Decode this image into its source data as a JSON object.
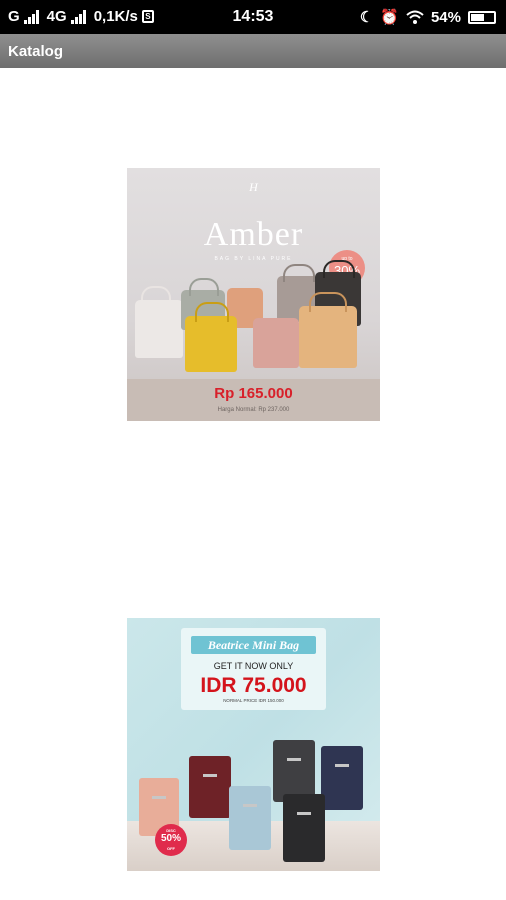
{
  "status_bar": {
    "carrier": "G",
    "network": "4G",
    "speed": "0,1K/s",
    "time": "14:53",
    "battery": "54%"
  },
  "app_bar": {
    "title": "Katalog"
  },
  "catalog": {
    "items": [
      {
        "brand_mark": "H",
        "title": "Amber",
        "subtitle": "BAG BY LINA PURE",
        "discount_small": "up to",
        "discount": "30%",
        "price": "Rp 165.000",
        "normal_price": "Harga Normal: Rp 237.000",
        "colors": [
          "#ece8e6",
          "#a9ada5",
          "#e6bd2b",
          "#dfa07c",
          "#d9a39a",
          "#a79b96",
          "#3a3736",
          "#e4b47e"
        ]
      },
      {
        "title": "Beatrice Mini Bag",
        "tagline": "GET IT NOW ONLY",
        "price": "IDR 75.000",
        "normal_price": "NORMAL PRICE IDR 150.000",
        "badge_top": "DISC",
        "badge": "50%",
        "badge_bottom": "OFF",
        "colors": [
          "#e8ad99",
          "#6e2227",
          "#a9c7d6",
          "#3f3f42",
          "#2f3552",
          "#2a2a2c"
        ]
      }
    ]
  },
  "theme": {
    "appbar": "#7d7d7d",
    "statusbar": "#000000",
    "accent_red": "#d4141c"
  }
}
